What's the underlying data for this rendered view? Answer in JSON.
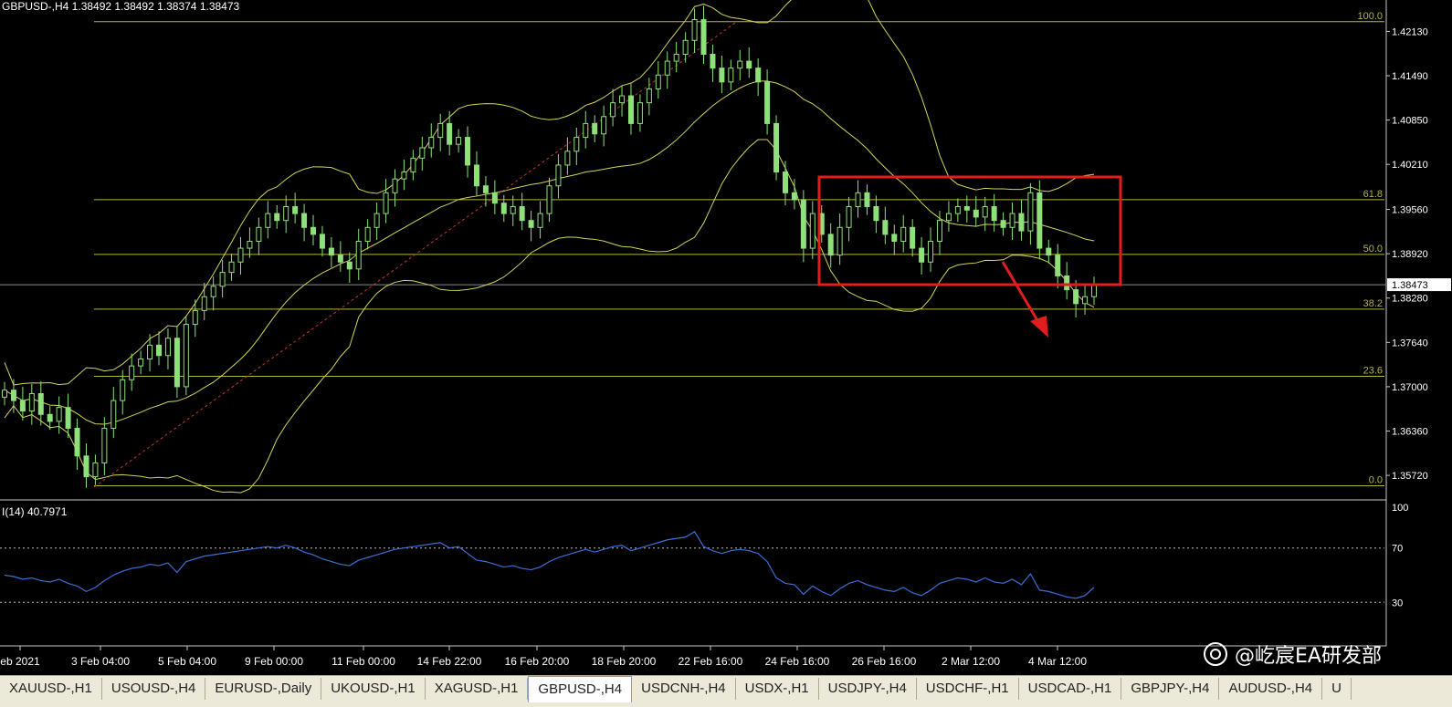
{
  "chart_data": [
    {
      "type": "candlestick",
      "symbol": "GBPUSD-,H4",
      "header": "GBPUSD-,H4  1.38492 1.38492 1.38374 1.38473",
      "ohlc_header": {
        "open": 1.38492,
        "high": 1.38492,
        "low": 1.38374,
        "close": 1.38473
      },
      "ylim": [
        1.3555,
        1.4232
      ],
      "y_ticks": [
        "1.42130",
        "1.41490",
        "1.40850",
        "1.40210",
        "1.39560",
        "1.38920",
        "1.38280",
        "1.37640",
        "1.37000",
        "1.36360",
        "1.35720"
      ],
      "current_price": "1.38473",
      "x_ticks": [
        "eb 2021",
        "3 Feb 04:00",
        "5 Feb 04:00",
        "9 Feb 00:00",
        "11 Feb 00:00",
        "14 Feb 22:00",
        "16 Feb 20:00",
        "18 Feb 20:00",
        "22 Feb 16:00",
        "24 Feb 16:00",
        "26 Feb 16:00",
        "2 Mar 12:00",
        "4 Mar 12:00"
      ],
      "fibonacci_levels": [
        {
          "label": "100.0",
          "price": 1.4227
        },
        {
          "label": "61.8",
          "price": 1.397
        },
        {
          "label": "50.0",
          "price": 1.3891
        },
        {
          "label": "38.2",
          "price": 1.3812
        },
        {
          "label": "23.6",
          "price": 1.3715
        },
        {
          "label": "0.0",
          "price": 1.3557
        }
      ],
      "close_series": [
        1.3695,
        1.368,
        1.3665,
        1.369,
        1.366,
        1.365,
        1.367,
        1.364,
        1.36,
        1.357,
        1.359,
        1.364,
        1.368,
        1.371,
        1.373,
        1.374,
        1.376,
        1.3745,
        1.377,
        1.37,
        1.379,
        1.381,
        1.383,
        1.3845,
        1.3865,
        1.388,
        1.39,
        1.391,
        1.393,
        1.395,
        1.394,
        1.396,
        1.395,
        1.393,
        1.392,
        1.39,
        1.389,
        1.388,
        1.387,
        1.391,
        1.393,
        1.395,
        1.398,
        1.4,
        1.401,
        1.403,
        1.4045,
        1.406,
        1.408,
        1.405,
        1.406,
        1.402,
        1.399,
        1.398,
        1.3965,
        1.395,
        1.396,
        1.394,
        1.393,
        1.395,
        1.399,
        1.402,
        1.404,
        1.406,
        1.408,
        1.4065,
        1.409,
        1.411,
        1.412,
        1.408,
        1.411,
        1.413,
        1.415,
        1.417,
        1.418,
        1.42,
        1.423,
        1.418,
        1.416,
        1.414,
        1.416,
        1.417,
        1.416,
        1.414,
        1.408,
        1.401,
        1.398,
        1.397,
        1.39,
        1.395,
        1.392,
        1.389,
        1.393,
        1.396,
        1.398,
        1.396,
        1.394,
        1.392,
        1.391,
        1.393,
        1.39,
        1.388,
        1.391,
        1.394,
        1.395,
        1.396,
        1.3955,
        1.3945,
        1.396,
        1.394,
        1.393,
        1.395,
        1.3925,
        1.398,
        1.39,
        1.389,
        1.386,
        1.384,
        1.382,
        1.383,
        1.3847
      ],
      "bollinger": {
        "period": 20
      },
      "annotations": [
        "red rectangle consolidation zone",
        "red downward arrow"
      ]
    },
    {
      "type": "line",
      "indicator": "RSI",
      "label": "I(14) 40.7971",
      "ylim": [
        0,
        100
      ],
      "levels": [
        "100",
        "70",
        "30"
      ],
      "values": [
        50,
        49,
        47,
        48,
        46,
        45,
        47,
        44,
        42,
        38,
        41,
        46,
        50,
        53,
        55,
        56,
        58,
        57,
        59,
        52,
        60,
        62,
        64,
        65,
        66,
        67,
        68,
        69,
        70,
        71,
        70,
        72,
        70,
        67,
        65,
        62,
        60,
        58,
        57,
        61,
        63,
        65,
        67,
        69,
        70,
        71,
        72,
        73,
        74,
        70,
        71,
        66,
        61,
        60,
        58,
        56,
        57,
        55,
        54,
        56,
        60,
        63,
        65,
        67,
        69,
        67,
        69,
        71,
        72,
        68,
        70,
        72,
        74,
        76,
        77,
        78,
        82,
        71,
        68,
        66,
        68,
        69,
        68,
        66,
        60,
        48,
        44,
        43,
        36,
        42,
        38,
        35,
        40,
        44,
        46,
        43,
        41,
        39,
        38,
        41,
        37,
        35,
        39,
        44,
        46,
        48,
        47,
        45,
        48,
        45,
        44,
        47,
        43,
        51,
        39,
        38,
        36,
        34,
        33,
        35,
        41
      ]
    }
  ],
  "watermark": "@屹宸EA研发部",
  "tabs": [
    "XAUUSD-,H1",
    "USOUSD-,H4",
    "EURUSD-,Daily",
    "UKOUSD-,H1",
    "XAGUSD-,H1",
    "GBPUSD-,H4",
    "USDCNH-,H4",
    "USDX-,H1",
    "USDJPY-,H4",
    "USDCHF-,H1",
    "USDCAD-,H1",
    "GBPJPY-,H4",
    "AUDUSD-,H4",
    "U"
  ],
  "active_tab": "GBPUSD-,H4",
  "colors": {
    "grid_line": "#b5b53a",
    "candle": "#8fe07a",
    "bollinger": "#d4d458",
    "rsi": "#3a6fd8",
    "annotation": "#e21d1d",
    "axis_text": "#ffffff"
  }
}
